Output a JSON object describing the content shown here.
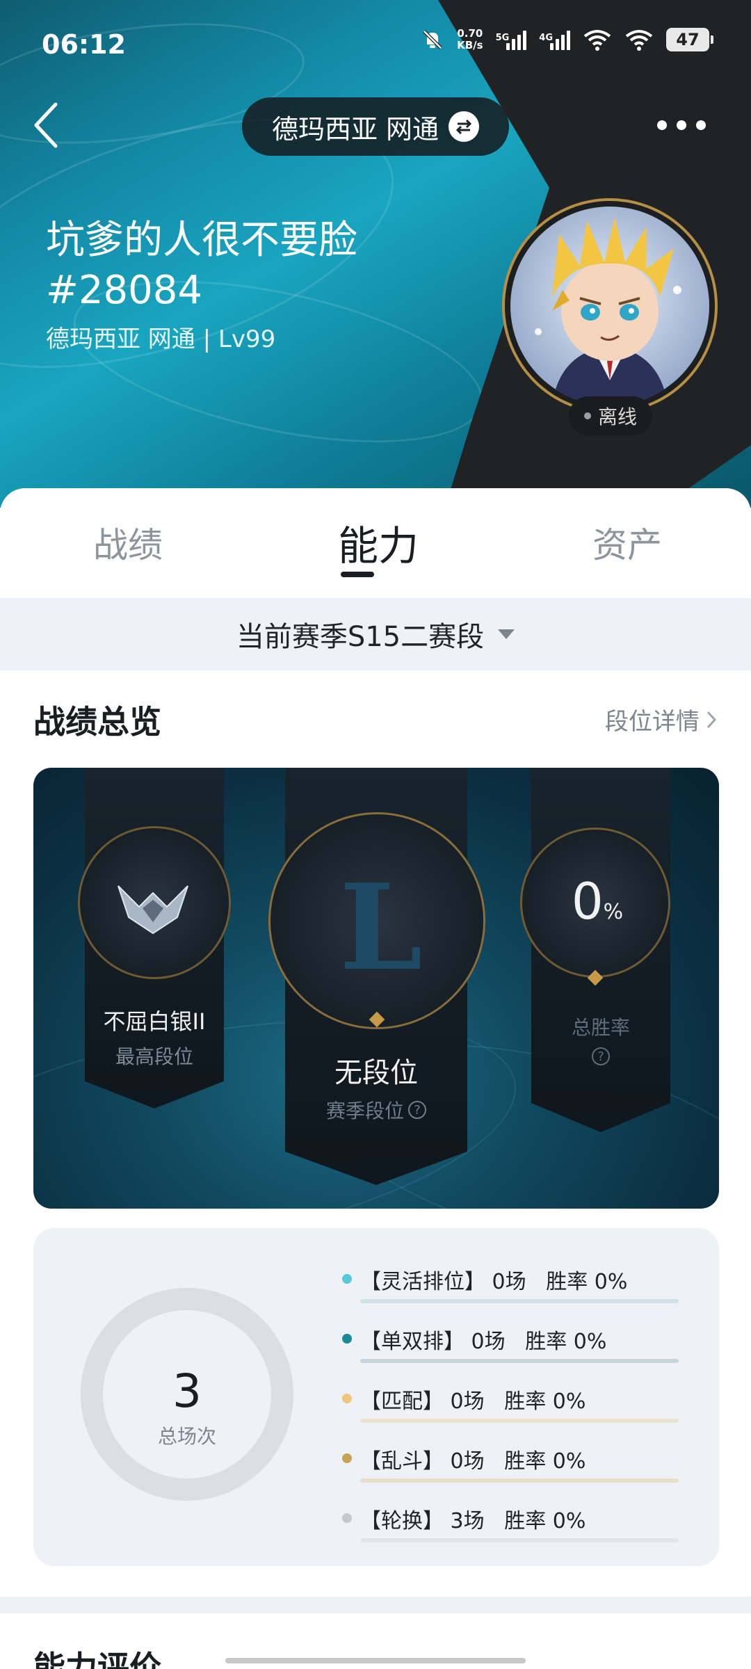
{
  "status_bar": {
    "time": "06:12",
    "net_speed_value": "0.70",
    "net_speed_unit": "KB/s",
    "sim1": "5G",
    "sim2": "4G",
    "battery": "47"
  },
  "header": {
    "server": "德玛西亚 网通",
    "player_name": "坑爹的人很不要脸",
    "player_tag": "#28084",
    "server_level": "德玛西亚 网通 | Lv99",
    "online_status": "离线"
  },
  "tabs": [
    {
      "label": "战绩",
      "active": false
    },
    {
      "label": "能力",
      "active": true
    },
    {
      "label": "资产",
      "active": false
    }
  ],
  "season_selector": {
    "label": "当前赛季S15二赛段"
  },
  "overview": {
    "title": "战绩总览",
    "detail_link": "段位详情",
    "highest_rank": {
      "value": "不屈白银II",
      "label": "最高段位"
    },
    "season_rank": {
      "emblem_letter": "L",
      "value": "无段位",
      "label": "赛季段位"
    },
    "win_rate": {
      "value": "0",
      "unit": "%",
      "label": "总胜率"
    }
  },
  "stats": {
    "total_games": "3",
    "total_label": "总场次",
    "modes": [
      {
        "text": "【灵活排位】 0场   胜率 0%",
        "dot_color": "#5bc8d8",
        "line_color": "#cfe2e7",
        "games": 0
      },
      {
        "text": "【单双排】 0场   胜率 0%",
        "dot_color": "#1a8a96",
        "line_color": "#c5d6dc",
        "games": 0
      },
      {
        "text": "【匹配】 0场   胜率 0%",
        "dot_color": "#f0c67c",
        "line_color": "#ece3cf",
        "games": 0
      },
      {
        "text": "【乱斗】 0场   胜率 0%",
        "dot_color": "#c9a25a",
        "line_color": "#e7dfca",
        "games": 0
      },
      {
        "text": "【轮换】 3场   胜率 0%",
        "dot_color": "#c4c8cf",
        "line_color": "#e2e5ea",
        "games": 3
      }
    ]
  },
  "ability": {
    "title": "能力评价"
  },
  "colors": {
    "accent_teal": "#19a5c0",
    "dark_panel": "#202224",
    "gold": "#c69a47",
    "page_bg": "#eef2f7"
  }
}
